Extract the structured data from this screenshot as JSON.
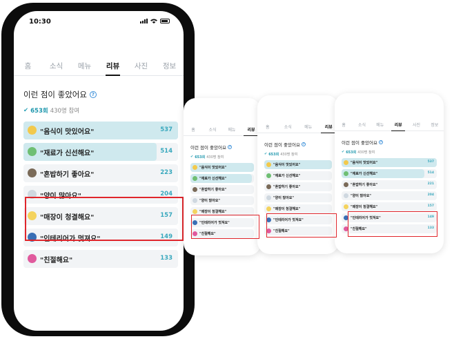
{
  "status": {
    "time": "10:30"
  },
  "tabs": [
    "홈",
    "소식",
    "메뉴",
    "리뷰",
    "사진",
    "정보"
  ],
  "active_tab": 3,
  "question": "이런 점이 좋았어요",
  "meta": {
    "count": "653회",
    "participants": "430명 참여"
  },
  "options": [
    {
      "label": "\"음식이 맛있어요\"",
      "count": "537",
      "fill": 1.0,
      "emoji_color": "#f2c94c"
    },
    {
      "label": "\"재료가 신선해요\"",
      "count": "514",
      "fill": 0.86,
      "emoji_color": "#6fbf73"
    },
    {
      "label": "\"혼밥하기 좋아요\"",
      "count": "223",
      "fill": 0.0,
      "emoji_color": "#7a6a58"
    },
    {
      "label": "\"양이 많아요\"",
      "count": "204",
      "fill": 0.0,
      "emoji_color": "#cfd8e0"
    },
    {
      "label": "\"매장이 청결해요\"",
      "count": "157",
      "fill": 0.0,
      "emoji_color": "#f4d35e"
    },
    {
      "label": "\"인테리어가 멋져요\"",
      "count": "149",
      "fill": 0.0,
      "emoji_color": "#3a6fb5"
    },
    {
      "label": "\"친절해요\"",
      "count": "133",
      "fill": 0.0,
      "emoji_color": "#e05a9d"
    }
  ],
  "minis": [
    {
      "tabs": [
        "홈",
        "소식",
        "메뉴",
        "리뷰"
      ],
      "active_tab": 3,
      "question": "이런 점이 좋았어요",
      "meta": {
        "count": "653회",
        "participants": "430명 참여"
      },
      "options": [
        {
          "label": "\"음식이 맛있어요\"",
          "count": "",
          "fill": 1.0,
          "emoji_color": "#f2c94c"
        },
        {
          "label": "\"재료가 신선해요\"",
          "count": "",
          "fill": 0.97,
          "emoji_color": "#6fbf73"
        },
        {
          "label": "\"혼밥하기 좋아요\"",
          "count": "",
          "fill": 0.0,
          "emoji_color": "#7a6a58"
        },
        {
          "label": "\"양이 많아요\"",
          "count": "",
          "fill": 0.0,
          "emoji_color": "#cfd8e0"
        },
        {
          "label": "\"매장이 청결해요\"",
          "count": "",
          "fill": 0.0,
          "emoji_color": "#f4d35e"
        },
        {
          "label": "\"인테리어가 멋져요\"",
          "count": "",
          "fill": 0.0,
          "emoji_color": "#3a6fb5"
        },
        {
          "label": "\"친절해요\"",
          "count": "",
          "fill": 0.0,
          "emoji_color": "#e05a9d"
        }
      ]
    },
    {
      "tabs": [
        "홈",
        "소식",
        "메뉴",
        "리뷰"
      ],
      "active_tab": 3,
      "question": "이런 점이 좋았어요",
      "meta": {
        "count": "653회",
        "participants": "430명 참여"
      },
      "options": [
        {
          "label": "\"음식이 맛있어요\"",
          "count": "",
          "fill": 1.0,
          "emoji_color": "#f2c94c"
        },
        {
          "label": "\"재료가 신선해요\"",
          "count": "",
          "fill": 0.0,
          "emoji_color": "#6fbf73"
        },
        {
          "label": "\"혼밥하기 좋아요\"",
          "count": "",
          "fill": 0.0,
          "emoji_color": "#7a6a58"
        },
        {
          "label": "\"양이 많아요\"",
          "count": "",
          "fill": 0.0,
          "emoji_color": "#cfd8e0"
        },
        {
          "label": "\"매장이 청결해요\"",
          "count": "",
          "fill": 0.0,
          "emoji_color": "#f4d35e"
        },
        {
          "label": "\"인테리어가 멋져요\"",
          "count": "",
          "fill": 0.0,
          "emoji_color": "#3a6fb5"
        },
        {
          "label": "\"친절해요\"",
          "count": "",
          "fill": 0.0,
          "emoji_color": "#e05a9d"
        }
      ]
    },
    {
      "tabs": [
        "홈",
        "소식",
        "메뉴",
        "리뷰",
        "사진",
        "정보"
      ],
      "active_tab": 3,
      "question": "이런 점이 좋았어요",
      "meta": {
        "count": "653회",
        "participants": "430명 참여"
      },
      "options": [
        {
          "label": "\"음식이 맛있어요\"",
          "count": "537",
          "fill": 1.0,
          "emoji_color": "#f2c94c"
        },
        {
          "label": "\"재료가 신선해요\"",
          "count": "514",
          "fill": 0.87,
          "emoji_color": "#6fbf73"
        },
        {
          "label": "\"혼밥하기 좋아요\"",
          "count": "221",
          "fill": 0.0,
          "emoji_color": "#7a6a58"
        },
        {
          "label": "\"양이 많아요\"",
          "count": "204",
          "fill": 0.0,
          "emoji_color": "#cfd8e0"
        },
        {
          "label": "\"매장이 청결해요\"",
          "count": "157",
          "fill": 0.0,
          "emoji_color": "#f4d35e"
        },
        {
          "label": "\"인테리어가 멋져요\"",
          "count": "149",
          "fill": 0.0,
          "emoji_color": "#3a6fb5"
        },
        {
          "label": "\"친절해요\"",
          "count": "133",
          "fill": 0.0,
          "emoji_color": "#e05a9d"
        }
      ]
    }
  ]
}
